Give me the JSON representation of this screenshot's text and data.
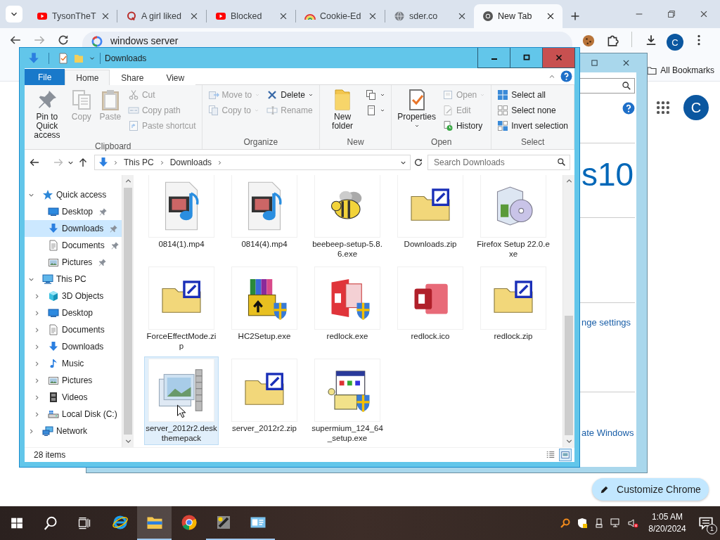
{
  "browser": {
    "tabs": [
      {
        "title": "TysonTheT",
        "kind": "youtube",
        "selected": false
      },
      {
        "title": "A girl liked",
        "kind": "quora",
        "selected": false
      },
      {
        "title": "Blocked",
        "kind": "youtube",
        "selected": false
      },
      {
        "title": "Cookie-Ed",
        "kind": "rainbow",
        "selected": false
      },
      {
        "title": "sder.co",
        "kind": "globe",
        "selected": false
      },
      {
        "title": "New Tab",
        "kind": "chrome",
        "selected": true
      }
    ],
    "address": "windows server",
    "profile": "C",
    "bookmarks": "All Bookmarks",
    "page_avatar": "C",
    "customize_button": "Customize Chrome"
  },
  "settings_window": {
    "heading": "s10",
    "links": [
      "nge settings",
      "ate Windows"
    ]
  },
  "explorer": {
    "title": "Downloads",
    "tabs": [
      {
        "label": "File",
        "kind": "file",
        "selected": false
      },
      {
        "label": "Home",
        "kind": "tab",
        "selected": true
      },
      {
        "label": "Share",
        "kind": "tab",
        "selected": false
      },
      {
        "label": "View",
        "kind": "tab",
        "selected": false
      }
    ],
    "ribbon": [
      {
        "label": "Clipboard",
        "large": [
          {
            "label": "Pin to Quick access",
            "kind": "pin",
            "disabled": false,
            "dropdown": false
          },
          {
            "label": "Copy",
            "kind": "copy",
            "disabled": true,
            "dropdown": false
          },
          {
            "label": "Paste",
            "kind": "paste",
            "disabled": true,
            "dropdown": false
          }
        ],
        "columns": [
          [
            {
              "label": "Cut",
              "kind": "cut",
              "disabled": true,
              "dropdown": false
            },
            {
              "label": "Copy path",
              "kind": "copy-path",
              "disabled": true,
              "dropdown": false
            },
            {
              "label": "Paste shortcut",
              "kind": "paste-shortcut",
              "disabled": true,
              "dropdown": false
            }
          ]
        ]
      },
      {
        "label": "Organize",
        "columns": [
          [
            {
              "label": "Move to",
              "kind": "move",
              "disabled": true,
              "dropdown": true
            },
            {
              "label": "Copy to",
              "kind": "copy-to",
              "disabled": true,
              "dropdown": true
            }
          ],
          [
            {
              "label": "Delete",
              "kind": "delete",
              "disabled": false,
              "dropdown": true
            },
            {
              "label": "Rename",
              "kind": "rename",
              "disabled": true,
              "dropdown": false
            }
          ]
        ]
      },
      {
        "label": "New",
        "large": [
          {
            "label": "New folder",
            "kind": "new-folder",
            "disabled": false,
            "dropdown": false
          }
        ],
        "columns": [
          [
            {
              "kind": "new-item",
              "disabled": false,
              "dropdown": true
            },
            {
              "kind": "easy-access",
              "disabled": false,
              "dropdown": true
            }
          ]
        ]
      },
      {
        "label": "Open",
        "large": [
          {
            "label": "Properties",
            "kind": "properties",
            "disabled": false,
            "dropdown": true
          }
        ],
        "columns": [
          [
            {
              "label": "Open",
              "kind": "open",
              "disabled": true,
              "dropdown": true
            },
            {
              "label": "Edit",
              "kind": "edit",
              "disabled": true,
              "dropdown": false
            },
            {
              "label": "History",
              "kind": "history",
              "disabled": false,
              "dropdown": false
            }
          ]
        ]
      },
      {
        "label": "Select",
        "columns": [
          [
            {
              "label": "Select all",
              "kind": "select-all",
              "disabled": false,
              "dropdown": false
            },
            {
              "label": "Select none",
              "kind": "select-none",
              "disabled": false,
              "dropdown": false
            },
            {
              "label": "Invert selection",
              "kind": "invert",
              "disabled": false,
              "dropdown": false
            }
          ]
        ]
      }
    ],
    "back_enabled": true,
    "forward_enabled": false,
    "path": [
      "This PC",
      "Downloads"
    ],
    "search": {
      "placeholder": "Search Downloads"
    },
    "nav": [
      {
        "label": "Quick access",
        "kind": "star",
        "expanded": true,
        "selected": false,
        "children": [
          {
            "label": "Desktop",
            "kind": "desktop",
            "pinned": true,
            "selected": false
          },
          {
            "label": "Downloads",
            "kind": "download",
            "pinned": true,
            "selected": true
          },
          {
            "label": "Documents",
            "kind": "document",
            "pinned": true,
            "selected": false
          },
          {
            "label": "Pictures",
            "kind": "pictures",
            "pinned": true,
            "selected": false
          }
        ]
      },
      {
        "label": "This PC",
        "kind": "pc",
        "expanded": true,
        "selected": false,
        "children": [
          {
            "label": "3D Objects",
            "kind": "cube",
            "expanded": false,
            "selected": false
          },
          {
            "label": "Desktop",
            "kind": "desktop",
            "expanded": false,
            "selected": false
          },
          {
            "label": "Documents",
            "kind": "document",
            "expanded": false,
            "selected": false
          },
          {
            "label": "Downloads",
            "kind": "download",
            "expanded": false,
            "selected": false
          },
          {
            "label": "Music",
            "kind": "music",
            "expanded": false,
            "selected": false
          },
          {
            "label": "Pictures",
            "kind": "pictures",
            "expanded": false,
            "selected": false
          },
          {
            "label": "Videos",
            "kind": "film",
            "expanded": false,
            "selected": false
          },
          {
            "label": "Local Disk (C:)",
            "kind": "drive",
            "expanded": false,
            "selected": false
          }
        ]
      },
      {
        "label": "Network",
        "kind": "network",
        "expanded": false,
        "selected": false
      }
    ],
    "files": [
      {
        "name": "0814(1).mp4",
        "kind": "video",
        "selected": false
      },
      {
        "name": "0814(4).mp4",
        "kind": "video",
        "selected": false
      },
      {
        "name": "beebeep-setup-5.8.6.exe",
        "kind": "bee",
        "selected": false
      },
      {
        "name": "Downloads.zip",
        "kind": "zip",
        "selected": false
      },
      {
        "name": "Firefox Setup 22.0.exe",
        "kind": "installer",
        "selected": false
      },
      {
        "name": "ForceEffectMode.zip",
        "kind": "zip",
        "selected": false
      },
      {
        "name": "HC2Setup.exe",
        "kind": "books",
        "selected": false
      },
      {
        "name": "redlock.exe",
        "kind": "red-app",
        "selected": false
      },
      {
        "name": "redlock.ico",
        "kind": "red-image",
        "selected": false
      },
      {
        "name": "redlock.zip",
        "kind": "zip",
        "selected": false
      },
      {
        "name": "server_2012r2.deskthemepack",
        "kind": "themepack",
        "selected": true
      },
      {
        "name": "server_2012r2.zip",
        "kind": "zip",
        "selected": false
      },
      {
        "name": "supermium_124_64_setup.exe",
        "kind": "setup",
        "selected": false
      }
    ],
    "status": "28 items",
    "views": [
      {
        "kind": "details",
        "selected": false
      },
      {
        "kind": "large-icons",
        "selected": true
      }
    ]
  },
  "taskbar": {
    "apps": [
      {
        "kind": "ie",
        "running": false,
        "active": false
      },
      {
        "kind": "folder",
        "running": true,
        "active": true
      },
      {
        "kind": "chrome",
        "running": false,
        "active": false
      },
      {
        "kind": "tool",
        "running": true,
        "active": false
      },
      {
        "kind": "window",
        "running": true,
        "active": false
      }
    ],
    "time": "1:05 AM",
    "date": "8/20/2024",
    "notifications": "1"
  }
}
